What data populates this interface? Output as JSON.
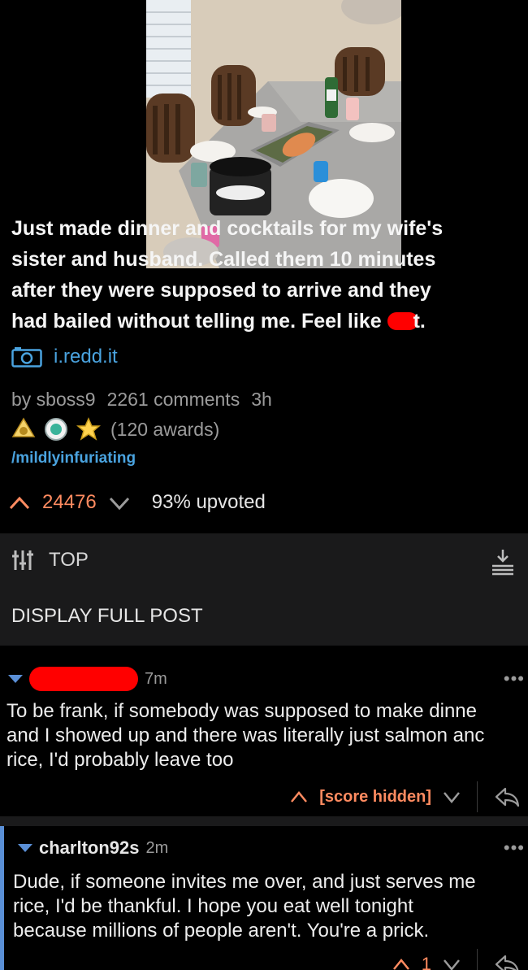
{
  "post": {
    "title_lines": [
      "Just made dinner and cocktails for my wife's",
      "sister and husband. Called them 10 minutes",
      "after they were supposed to arrive and they",
      "had bailed without telling me. Feel like"
    ],
    "title_end": "t.",
    "link_domain": "i.redd.it",
    "author": "by sboss9",
    "comments": "2261 comments",
    "age": "3h",
    "awards_count": "(120 awards)",
    "subreddit": "/mildlyinfuriating",
    "score": "24476",
    "upvoted": "93% upvoted"
  },
  "sort": {
    "label": "TOP",
    "display_full": "DISPLAY FULL POST"
  },
  "comments": [
    {
      "author": "",
      "time": "7m",
      "lines": [
        "To be frank, if somebody was supposed to make dinne",
        "and I showed up and there was literally just salmon anc",
        "rice, I'd probably leave too"
      ],
      "score": "[score hidden]"
    },
    {
      "author": "charlton92s",
      "time": "2m",
      "lines": [
        "Dude, if someone invites me over, and just serves me",
        "rice, I'd be thankful. I hope you eat well tonight",
        "because millions of people aren't. You're a prick."
      ],
      "score": "1"
    }
  ],
  "icons": {
    "more": "•••"
  },
  "colors": {
    "link_blue": "#4aa3df",
    "upvote_orange": "#ff8b60",
    "redaction_red": "#ff0000",
    "thread_blue": "#5a8fd6"
  }
}
